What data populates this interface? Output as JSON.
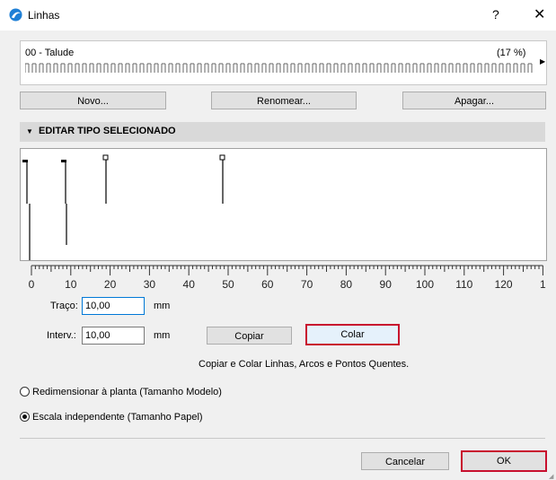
{
  "window": {
    "title": "Linhas",
    "help_label": "?",
    "close_label": "✕"
  },
  "preview": {
    "name": "00 - Talude",
    "percent": "(17 %)"
  },
  "buttons": {
    "new": "Novo...",
    "rename": "Renomear...",
    "delete": "Apagar..."
  },
  "section": {
    "title": "EDITAR TIPO SELECIONADO"
  },
  "ruler": {
    "labels": [
      "0",
      "10",
      "20",
      "30",
      "40",
      "50",
      "60",
      "70",
      "80",
      "90",
      "100",
      "110",
      "120",
      "1"
    ]
  },
  "fields": {
    "dash_label": "Traço:",
    "dash_value": "10,00",
    "dash_unit": "mm",
    "gap_label": "Interv.:",
    "gap_value": "10,00",
    "gap_unit": "mm"
  },
  "clipboard": {
    "copy": "Copiar",
    "paste": "Colar",
    "hint": "Copiar e Colar Linhas, Arcos e Pontos Quentes."
  },
  "scale": {
    "option1": "Redimensionar à planta (Tamanho Modelo)",
    "option2": "Escala independente (Tamanho Papel)",
    "selected": 2
  },
  "footer": {
    "cancel": "Cancelar",
    "ok": "OK"
  },
  "colors": {
    "highlight": "#c8102e",
    "focus": "#0078d7"
  }
}
